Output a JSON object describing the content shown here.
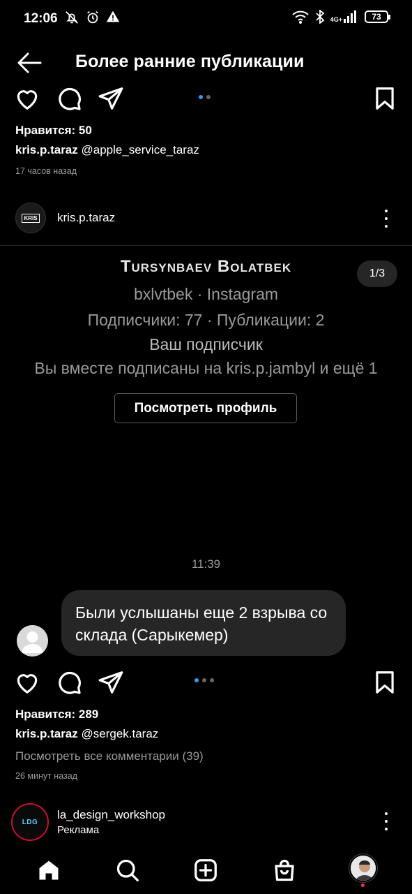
{
  "status_bar": {
    "time": "12:06",
    "network": "4G+",
    "battery": "73"
  },
  "header": {
    "title": "Более ранние публикации"
  },
  "post1": {
    "likes": "Нравится: 50",
    "caption_user": "kris.p.taraz",
    "caption_text": "@apple_service_taraz",
    "time_ago": "17 часов назад"
  },
  "post2": {
    "author": "kris.p.taraz",
    "avatar_text": "KRIS",
    "card": {
      "name": "Tursynbaev Bolatbek",
      "handle": "bxlvtbek · Instagram",
      "stats": "Подписчики: 77 · Публикации: 2",
      "follower": "Ваш подписчик",
      "mutual": "Вы вместе подписаны на kris.p.jambyl и ещё 1",
      "counter": "1/3",
      "button": "Посмотреть профиль"
    },
    "message_time": "11:39",
    "message_text": "Были услышаны еще 2 взрыва со склада (Сарыкемер)",
    "likes": "Нравится: 289",
    "caption_user": "kris.p.taraz",
    "caption_text": "@sergek.taraz",
    "view_comments": "Посмотреть все комментарии (39)",
    "time_ago": "26 минут назад"
  },
  "post3": {
    "author": "la_design_workshop",
    "sponsored": "Реклама",
    "avatar_text": "LDG"
  },
  "icons": {
    "back": "arrow-left-icon",
    "like": "heart-icon",
    "comment": "comment-icon",
    "share": "send-icon",
    "save": "bookmark-icon",
    "more": "more-vertical-icon",
    "home": "home-icon",
    "search": "search-icon",
    "create": "plus-square-icon",
    "shop": "shopping-bag-icon"
  },
  "colors": {
    "background": "#000000",
    "accent": "#3897f0",
    "secondary_text": "#9a9a9a",
    "bubble": "#262626",
    "notification": "#ff2d55"
  }
}
